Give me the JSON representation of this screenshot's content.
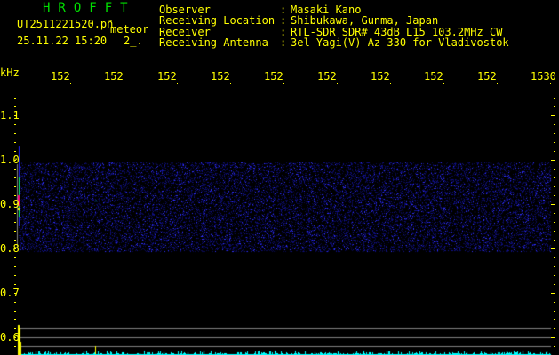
{
  "header": {
    "title": "HROFFT",
    "filename": "UT2511221520.pn",
    "filename_suffix": "~",
    "type": "meteor",
    "datetime": "25.11.22 15:20",
    "count": "2_."
  },
  "info": [
    {
      "label": "Observer",
      "value": "Masaki Kano"
    },
    {
      "label": "Receiving Location",
      "value": "Shibukawa, Gunma, Japan"
    },
    {
      "label": "Receiver",
      "value": "RTL-SDR SDR# 43dB L15 103.2MHz CW"
    },
    {
      "label": "Receiving Antenna",
      "value": "3el Yagi(V) Az 330 for Vladivostok"
    }
  ],
  "axis": {
    "y_unit": "kHz",
    "x_labels": [
      "152",
      "152",
      "152",
      "152",
      "152",
      "152",
      "152",
      "152",
      "152",
      "1530"
    ],
    "y_labels": [
      "1.1",
      "1.0",
      "0.9",
      "0.8",
      "0.7",
      "0.6"
    ]
  },
  "colors": {
    "text": "#ffff00",
    "title": "#00e000",
    "noise": "#1a1aff",
    "spectrum": "#00ffff",
    "grid": "#808080"
  }
}
